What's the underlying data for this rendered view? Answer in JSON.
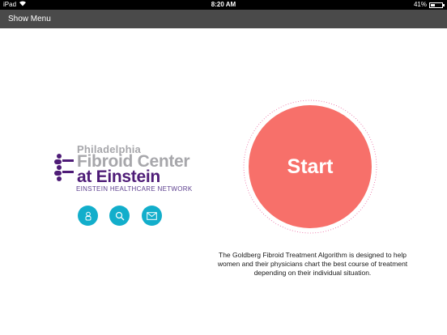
{
  "statusbar": {
    "device": "iPad",
    "time": "8:20 AM",
    "battery": "41%",
    "battery_level": 0.41
  },
  "menubar": {
    "show_menu_label": "Show Menu"
  },
  "logo": {
    "line1": "Philadelphia",
    "line2": "Fibroid Center",
    "line3": "at Einstein",
    "line4": "EINSTEIN HEALTHCARE NETWORK"
  },
  "actions": [
    {
      "icon": "person-icon"
    },
    {
      "icon": "search-icon"
    },
    {
      "icon": "mail-icon"
    }
  ],
  "start": {
    "label": "Start"
  },
  "description": {
    "text": "The Goldberg Fibroid Treatment Algorithm is designed to help women and their physicians chart the best course of treatment depending on their individual situation."
  },
  "colors": {
    "accent_blue": "#12aecb",
    "start_red": "#f7706a",
    "logo_purple": "#4e1c77",
    "logo_gray": "#a7a7ab",
    "menubar": "#4a4a4a"
  }
}
